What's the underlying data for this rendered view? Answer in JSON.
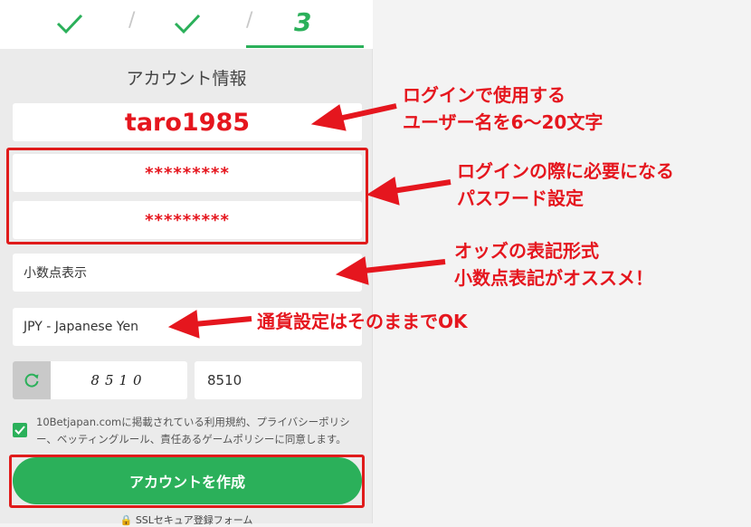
{
  "steps": {
    "current": "3"
  },
  "form": {
    "title": "アカウント情報",
    "username": "taro1985",
    "password": "*********",
    "password_confirm": "*********",
    "odds_format": "小数点表示",
    "currency": "JPY - Japanese Yen",
    "captcha_image_text": "8510",
    "captcha_input": "8510",
    "terms": "10Betjapan.comに掲載されている利用規約、プライバシーポリシー、ベッティングルール、責任あるゲームポリシーに同意します。",
    "submit_label": "アカウントを作成",
    "secure_label": "SSLセキュア登録フォーム"
  },
  "annotations": {
    "username_line1": "ログインで使用する",
    "username_line2": "ユーザー名を6〜20文字",
    "password_line1": "ログインの際に必要になる",
    "password_line2": "パスワード設定",
    "odds_line1": "オッズの表記形式",
    "odds_line2": "小数点表記がオススメ！",
    "currency_line1": "通貨設定はそのままでOK"
  },
  "colors": {
    "accent": "#2bb05a",
    "annotation": "#e5161e"
  }
}
